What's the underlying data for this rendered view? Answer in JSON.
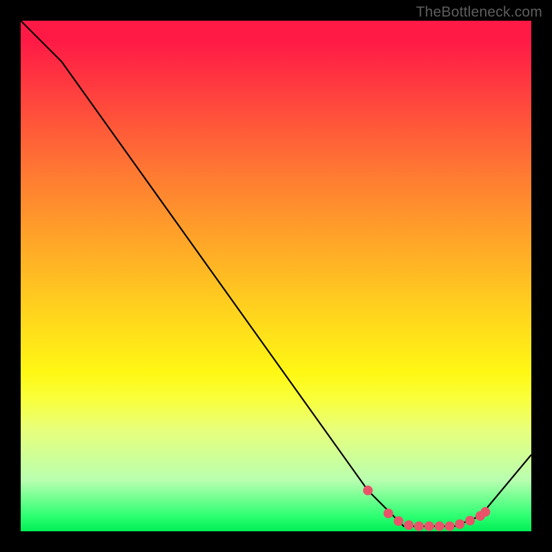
{
  "watermark": "TheBottleneck.com",
  "chart_data": {
    "type": "line",
    "title": "",
    "xlabel": "",
    "ylabel": "",
    "xlim": [
      0,
      100
    ],
    "ylim": [
      0,
      100
    ],
    "series": [
      {
        "name": "bottleneck-curve",
        "color": "#000000",
        "x": [
          0,
          8,
          68,
          75,
          85,
          90,
          100
        ],
        "y": [
          100,
          92,
          8,
          1,
          1,
          3,
          15
        ]
      }
    ],
    "markers": {
      "name": "optimal-zone",
      "color": "#e9536a",
      "x": [
        68,
        72,
        74,
        76,
        78,
        80,
        82,
        84,
        86,
        88,
        90,
        91
      ],
      "y": [
        8,
        3.5,
        2,
        1.2,
        1,
        1,
        1,
        1,
        1.4,
        2.1,
        3,
        3.8
      ]
    },
    "gradient_stops": [
      {
        "pos": 0,
        "color": "#ff1a46"
      },
      {
        "pos": 50,
        "color": "#ffd01e"
      },
      {
        "pos": 75,
        "color": "#fff814"
      },
      {
        "pos": 100,
        "color": "#00ee55"
      }
    ]
  }
}
